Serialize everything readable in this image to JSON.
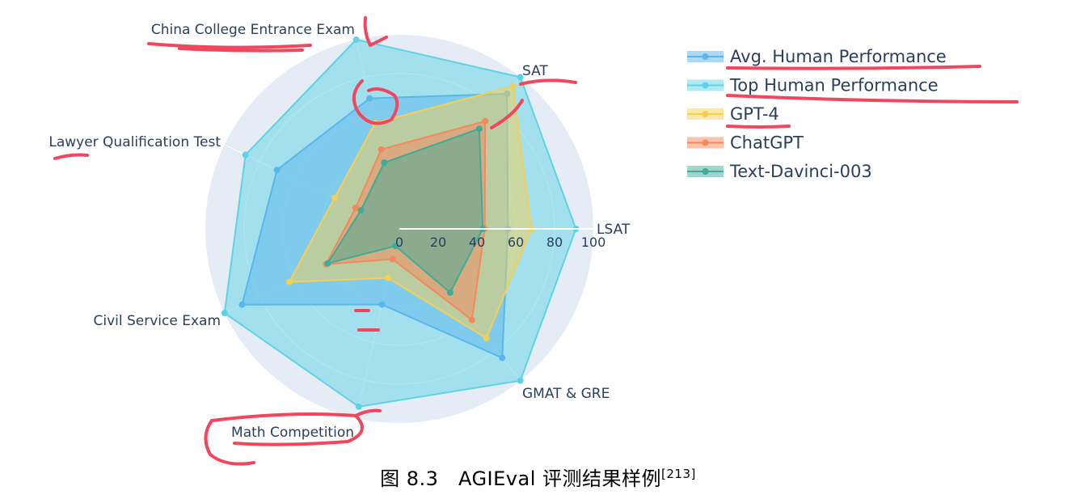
{
  "chart_data": {
    "type": "radar",
    "axes": [
      "LSAT",
      "SAT",
      "China College Entrance Exam",
      "Lawyer Qualification Test",
      "Civil Service Exam",
      "Math Competition",
      "GMAT & GRE"
    ],
    "radial_ticks": [
      "0",
      "20",
      "40",
      "60",
      "80",
      "100"
    ],
    "range": [
      0,
      100
    ],
    "series": [
      {
        "name": "Avg. Human Performance",
        "color": "#5ab6ec",
        "values": [
          56,
          89,
          69,
          70,
          90,
          40,
          85
        ]
      },
      {
        "name": "Top Human Performance",
        "color": "#5fd3e6",
        "values": [
          91,
          100,
          100,
          88,
          100,
          94,
          100
        ]
      },
      {
        "name": "GPT-4",
        "color": "#f5cf55",
        "values": [
          68,
          94,
          56,
          37,
          63,
          26,
          72
        ]
      },
      {
        "name": "ChatGPT",
        "color": "#f4895e",
        "values": [
          44,
          71,
          42,
          25,
          42,
          16,
          60
        ]
      },
      {
        "name": "Text-Davinci-003",
        "color": "#3fab99",
        "values": [
          43,
          66,
          35,
          22,
          41,
          9,
          42
        ]
      }
    ]
  },
  "caption": {
    "text": "图 8.3　AGIEval 评测结果样例",
    "ref": "[213]"
  }
}
